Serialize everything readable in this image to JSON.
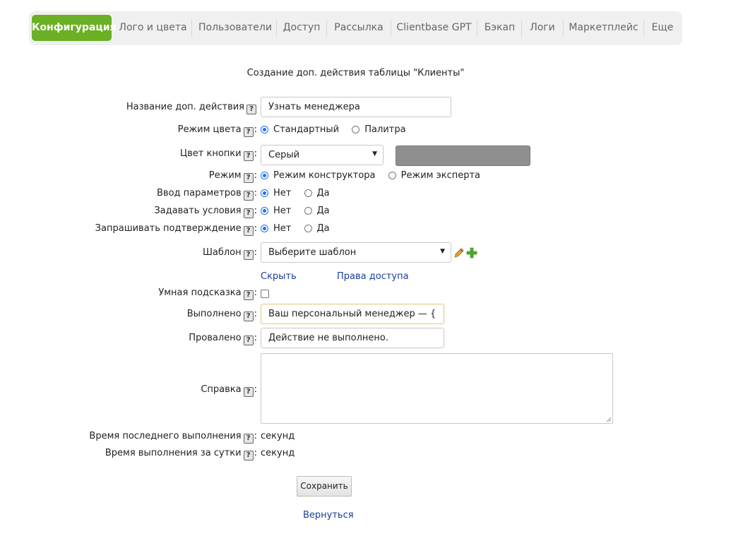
{
  "tabs": [
    {
      "label": "Конфигурация",
      "active": true
    },
    {
      "label": "Лого и цвета"
    },
    {
      "label": "Пользователи"
    },
    {
      "label": "Доступ"
    },
    {
      "label": "Рассылка"
    },
    {
      "label": "Clientbase GPT"
    },
    {
      "label": "Бэкап"
    },
    {
      "label": "Логи"
    },
    {
      "label": "Маркетплейс"
    },
    {
      "label": "Еще"
    }
  ],
  "heading": "Создание доп. действия таблицы \"Клиенты\"",
  "help_glyph": "?",
  "form": {
    "name": {
      "label": "Название доп. действия",
      "value": "Узнать менеджера"
    },
    "color_mode": {
      "label": "Режим цвета",
      "options": [
        "Стандартный",
        "Палитра"
      ],
      "selected": "Стандартный"
    },
    "button_color": {
      "label": "Цвет кнопки",
      "value": "Серый",
      "swatch": "#8f8f8f"
    },
    "mode": {
      "label": "Режим",
      "options": [
        "Режим конструктора",
        "Режим эксперта"
      ],
      "selected": "Режим конструктора"
    },
    "input_params": {
      "label": "Ввод параметров",
      "options": [
        "Нет",
        "Да"
      ],
      "selected": "Нет"
    },
    "set_conditions": {
      "label": "Задавать условия",
      "options": [
        "Нет",
        "Да"
      ],
      "selected": "Нет"
    },
    "ask_confirm": {
      "label": "Запрашивать подтверждение",
      "options": [
        "Нет",
        "Да"
      ],
      "selected": "Нет"
    },
    "template": {
      "label": "Шаблон",
      "value": "Выберите шаблон"
    },
    "links": {
      "hide": "Скрыть",
      "access": "Права доступа"
    },
    "smart_hint": {
      "label": "Умная подсказка",
      "checked": false
    },
    "done": {
      "label": "Выполнено",
      "value": "Ваш персональный менеджер — {Менед"
    },
    "failed": {
      "label": "Провалено",
      "value": "Действие не выполнено."
    },
    "help_text": {
      "label": "Справка",
      "value": ""
    },
    "last_exec": {
      "label": "Время последнего выполнения",
      "value": "секунд"
    },
    "daily_exec": {
      "label": "Время выполнения за сутки",
      "value": "секунд"
    }
  },
  "actions": {
    "save": "Сохранить",
    "back": "Вернуться"
  },
  "colors": {
    "accent": "#6bb025",
    "link": "#1a3c9e"
  }
}
